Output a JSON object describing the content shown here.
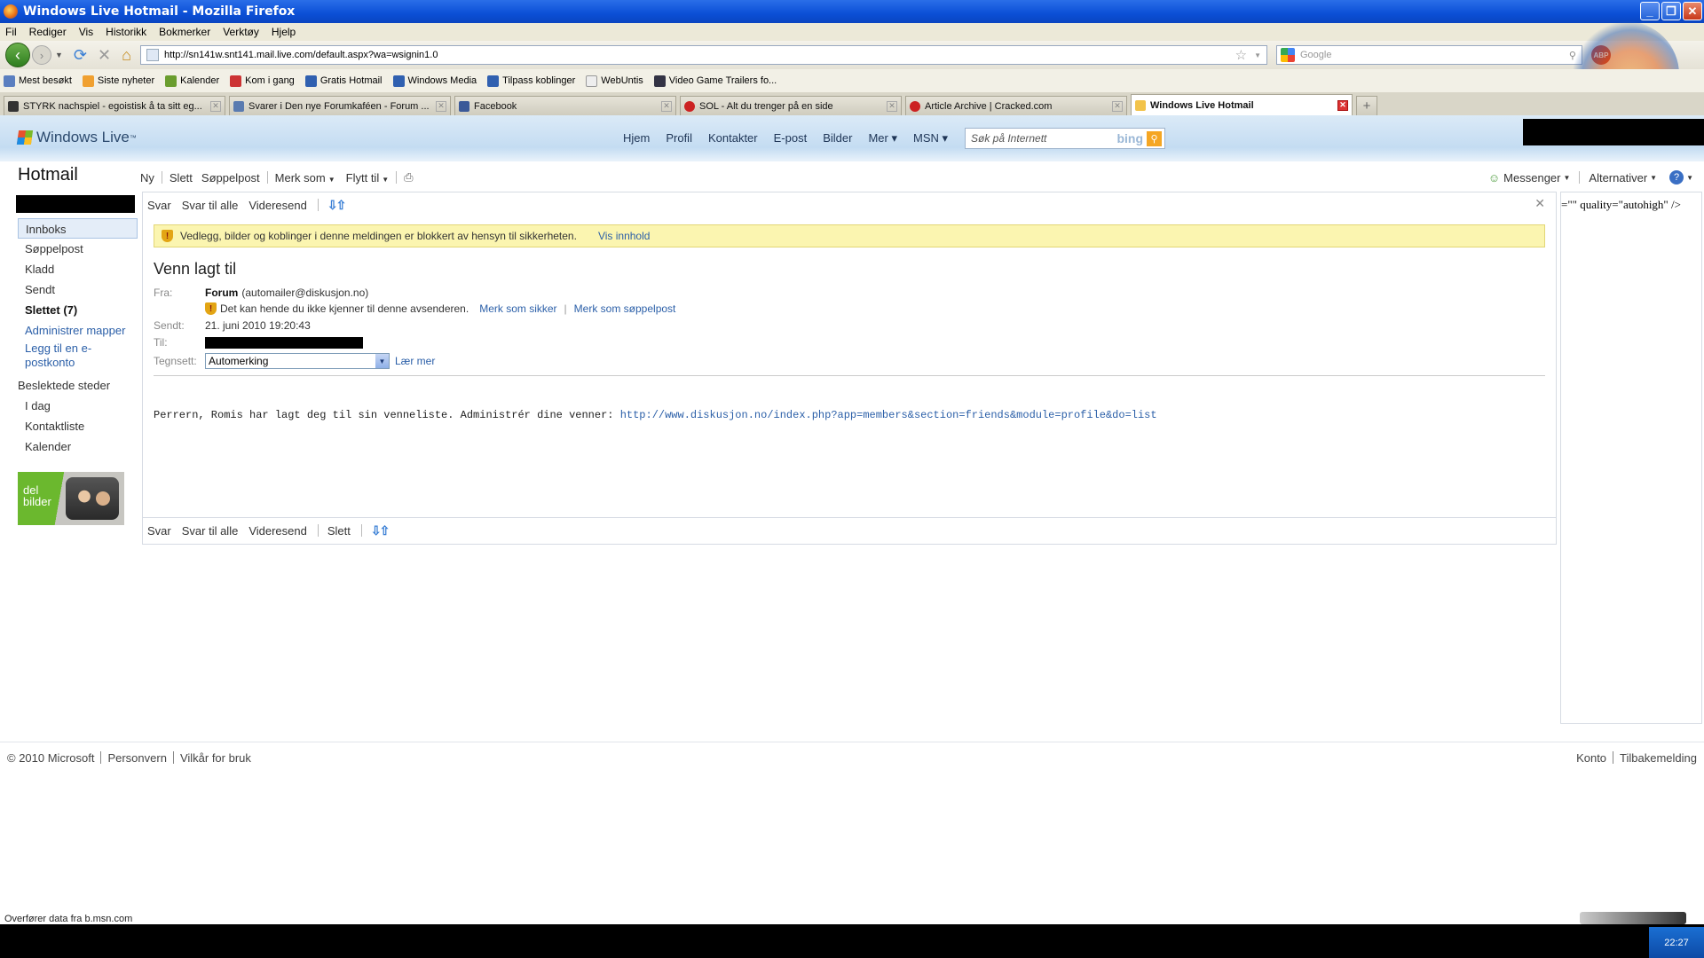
{
  "window": {
    "title": "Windows Live Hotmail - Mozilla Firefox"
  },
  "menu": [
    "Fil",
    "Rediger",
    "Vis",
    "Historikk",
    "Bokmerker",
    "Verktøy",
    "Hjelp"
  ],
  "address": {
    "url": "http://sn141w.snt141.mail.live.com/default.aspx?wa=wsignin1.0"
  },
  "search": {
    "placeholder": "Google"
  },
  "abp": {
    "label": "ABP"
  },
  "bookmarks": [
    {
      "label": "Mest besøkt",
      "color": "#5b7fc0"
    },
    {
      "label": "Siste nyheter",
      "color": "#f0a030"
    },
    {
      "label": "Kalender",
      "color": "#6a9d2e"
    },
    {
      "label": "Kom i gang",
      "color": "#c33"
    },
    {
      "label": "Gratis Hotmail",
      "color": "#3060b0"
    },
    {
      "label": "Windows Media",
      "color": "#3060b0"
    },
    {
      "label": "Tilpass koblinger",
      "color": "#3060b0"
    },
    {
      "label": "WebUntis",
      "color": "#eee"
    },
    {
      "label": "Video Game Trailers fo...",
      "color": "#334"
    }
  ],
  "tabs": [
    {
      "label": "STYRK nachspiel - egoistisk å ta sitt eg...",
      "color": "#333",
      "active": false
    },
    {
      "label": "Svarer i Den nye Forumkaféen - Forum ...",
      "color": "#5a7bb0",
      "active": false
    },
    {
      "label": "Facebook",
      "color": "#3b5998",
      "active": false
    },
    {
      "label": "SOL - Alt du trenger på en side",
      "color": "#c22",
      "active": false
    },
    {
      "label": "Article Archive | Cracked.com",
      "color": "#c22",
      "active": false
    },
    {
      "label": "Windows Live Hotmail",
      "color": "#f2c34a",
      "active": true
    }
  ],
  "wl": {
    "brand": "Windows Live",
    "brand_tm": "™",
    "nav": [
      "Hjem",
      "Profil",
      "Kontakter",
      "E-post",
      "Bilder",
      "Mer ▾",
      "MSN ▾"
    ],
    "search_placeholder": "Søk på Internett",
    "bing": "bing"
  },
  "hotmail": {
    "title": "Hotmail",
    "commands": [
      "Ny",
      "Slett",
      "Søppelpost",
      "Merk som",
      "Flytt til"
    ],
    "right": {
      "messenger": "Messenger",
      "options": "Alternativer"
    }
  },
  "folders": [
    {
      "label": "Innboks",
      "selected": true,
      "bold": false
    },
    {
      "label": "Søppelpost",
      "selected": false,
      "bold": false
    },
    {
      "label": "Kladd",
      "selected": false,
      "bold": false
    },
    {
      "label": "Sendt",
      "selected": false,
      "bold": false
    },
    {
      "label": "Slettet (7)",
      "selected": false,
      "bold": true
    }
  ],
  "leftnav": {
    "manage_folders": "Administrer mapper",
    "add_account": "Legg til en e-postkonto",
    "related_title": "Beslektede steder",
    "related": [
      "I dag",
      "Kontaktliste",
      "Kalender"
    ],
    "promo": "del bilder"
  },
  "message": {
    "actions": [
      "Svar",
      "Svar til alle",
      "Videresend"
    ],
    "bottom_actions": [
      "Svar",
      "Svar til alle",
      "Videresend",
      "Slett"
    ],
    "warning": "Vedlegg, bilder og koblinger i denne meldingen er blokkert av hensyn til sikkerheten.",
    "show_content": "Vis innhold",
    "subject": "Venn lagt til",
    "from_label": "Fra:",
    "from_name": "Forum",
    "from_email": "(automailer@diskusjon.no)",
    "sender_note": "Det kan hende du ikke kjenner til denne avsenderen.",
    "mark_safe": "Merk som sikker",
    "mark_junk": "Merk som søppelpost",
    "sent_label": "Sendt:",
    "sent_value": "21. juni 2010 19:20:43",
    "to_label": "Til:",
    "charset_label": "Tegnsett:",
    "charset_value": "Automerking",
    "learn_more": "Lær mer",
    "body_text": "Perrern, Romis har lagt deg til sin venneliste. Administrér dine venner: ",
    "body_link": "http://www.diskusjon.no/index.php?app=members&section=friends&module=profile&do=list"
  },
  "rightcol": {
    "text": "=\"\" quality=\"autohigh\" />"
  },
  "footer": {
    "left": [
      "© 2010 Microsoft",
      "Personvern",
      "Vilkår for bruk"
    ],
    "right": [
      "Konto",
      "Tilbakemelding"
    ]
  },
  "status": {
    "text": "Overfører data fra b.msn.com",
    "clock": "22:27"
  }
}
